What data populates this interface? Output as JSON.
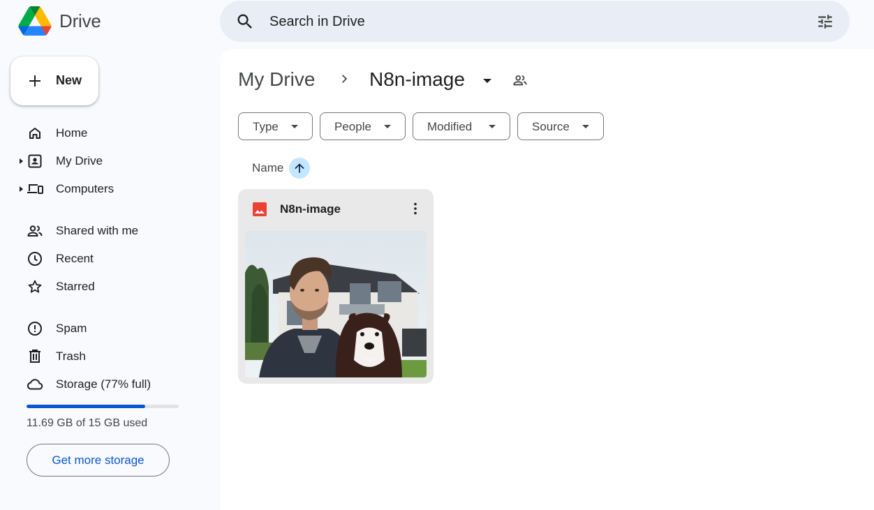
{
  "app": {
    "name": "Drive"
  },
  "search": {
    "placeholder": "Search in Drive"
  },
  "new_button": {
    "label": "New"
  },
  "sidebar": {
    "items": [
      {
        "id": "home",
        "label": "Home",
        "icon": "home-icon"
      },
      {
        "id": "my-drive",
        "label": "My Drive",
        "icon": "my-drive-icon",
        "expandable": true
      },
      {
        "id": "computers",
        "label": "Computers",
        "icon": "computers-icon",
        "expandable": true
      },
      {
        "id": "shared",
        "label": "Shared with me",
        "icon": "people-icon"
      },
      {
        "id": "recent",
        "label": "Recent",
        "icon": "clock-icon"
      },
      {
        "id": "starred",
        "label": "Starred",
        "icon": "star-icon"
      },
      {
        "id": "spam",
        "label": "Spam",
        "icon": "spam-icon"
      },
      {
        "id": "trash",
        "label": "Trash",
        "icon": "trash-icon"
      },
      {
        "id": "storage",
        "label": "Storage (77% full)",
        "icon": "cloud-icon"
      }
    ]
  },
  "storage": {
    "used_text": "11.69 GB of 15 GB used",
    "fraction": 0.779,
    "button_label": "Get more storage"
  },
  "breadcrumb": {
    "root": "My Drive",
    "current": "N8n-image"
  },
  "filters": [
    {
      "label": "Type"
    },
    {
      "label": "People"
    },
    {
      "label": "Modified"
    },
    {
      "label": "Source"
    }
  ],
  "sort": {
    "label": "Name",
    "direction": "ascending"
  },
  "files": [
    {
      "name": "N8n-image",
      "type": "image"
    }
  ],
  "colors": {
    "accent": "#0b57d0",
    "background": "#f8fafd",
    "search_bg": "#e9eef6",
    "sort_chip": "#c2e7ff",
    "image_icon": "#ea4335"
  }
}
